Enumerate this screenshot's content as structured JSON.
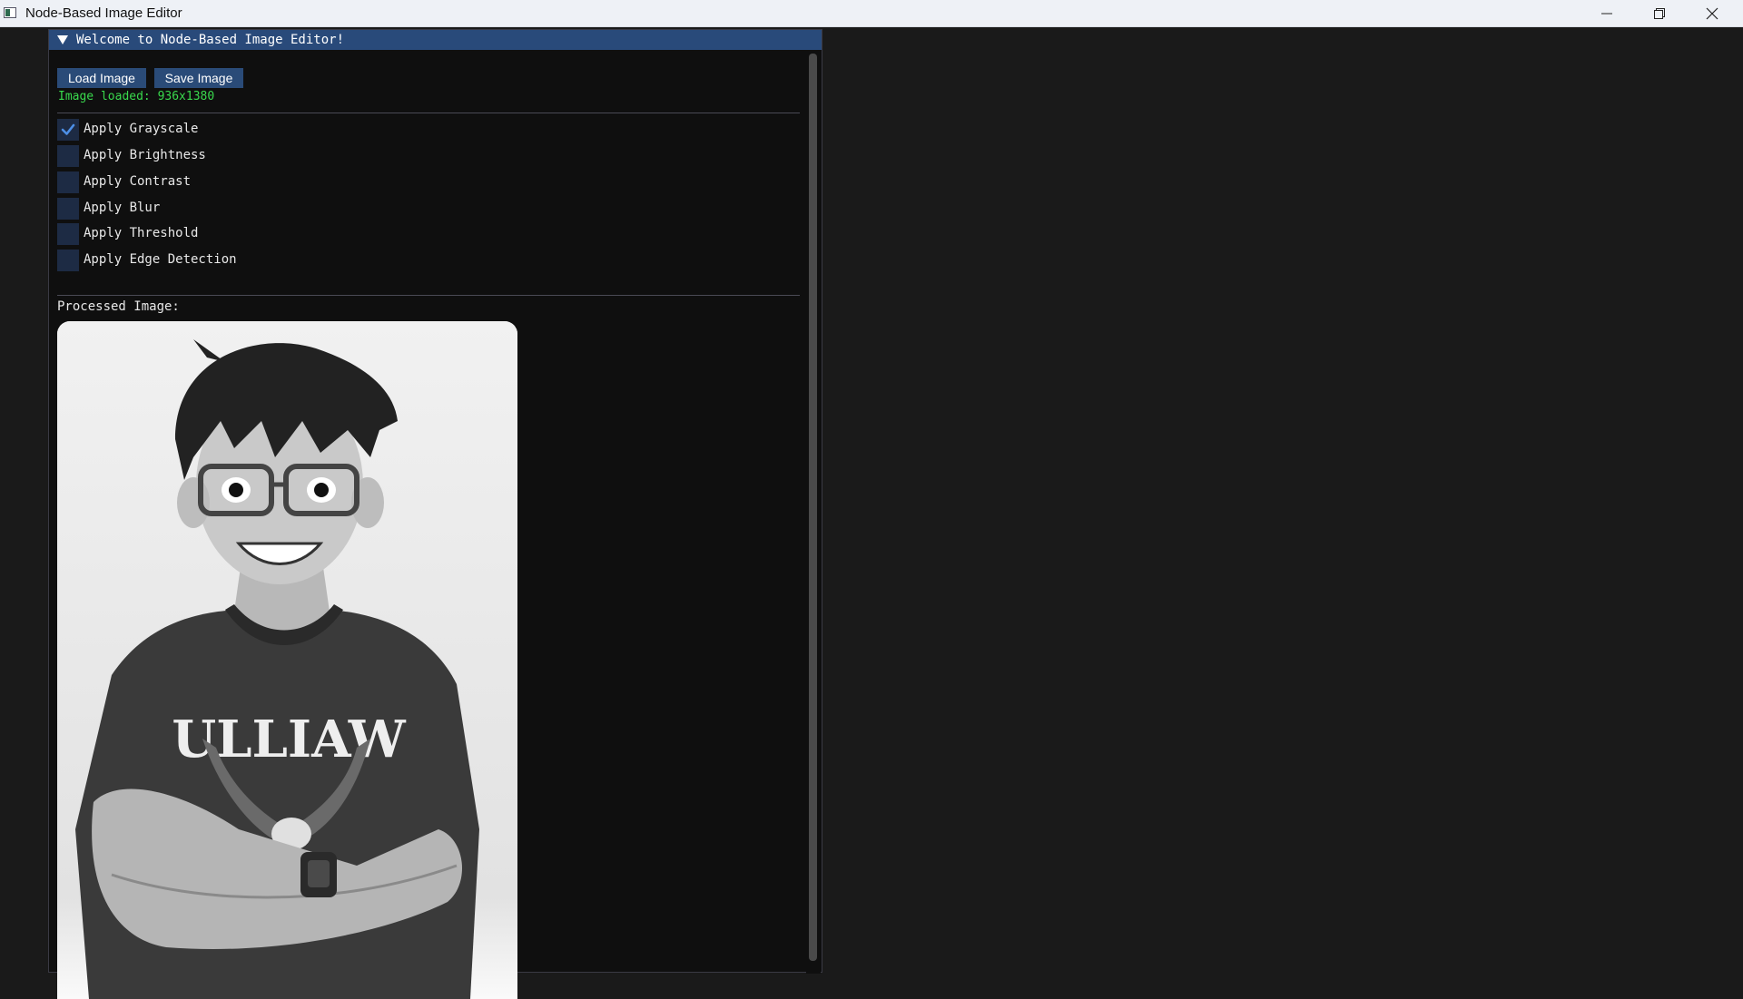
{
  "window": {
    "title": "Node-Based Image Editor"
  },
  "panel": {
    "title": "Welcome to Node-Based Image Editor!"
  },
  "buttons": {
    "load_label": "Load Image",
    "save_label": "Save Image"
  },
  "status": {
    "text": "Image loaded: 936x1380",
    "color": "#39d94d"
  },
  "filters": [
    {
      "label": "Apply Grayscale",
      "checked": true
    },
    {
      "label": "Apply Brightness",
      "checked": false
    },
    {
      "label": "Apply Contrast",
      "checked": false
    },
    {
      "label": "Apply Blur",
      "checked": false
    },
    {
      "label": "Apply Threshold",
      "checked": false
    },
    {
      "label": "Apply Edge Detection",
      "checked": false
    }
  ],
  "processed": {
    "label": "Processed Image:",
    "image_icon": "grayscale-portrait-illustration",
    "shirt_text": "ULLIAW"
  },
  "colors": {
    "accent": "#294a7a",
    "button": "#2a4b78",
    "checkbox": "#1d2b44",
    "check_mark": "#4d8fe6",
    "background": "#1a1a1a",
    "panel_bg": "#0f0f0f"
  },
  "icons": {
    "collapse": "triangle-down-icon",
    "check": "checkmark-icon",
    "minimize": "minimize-icon",
    "restore": "restore-icon",
    "close": "close-icon"
  }
}
